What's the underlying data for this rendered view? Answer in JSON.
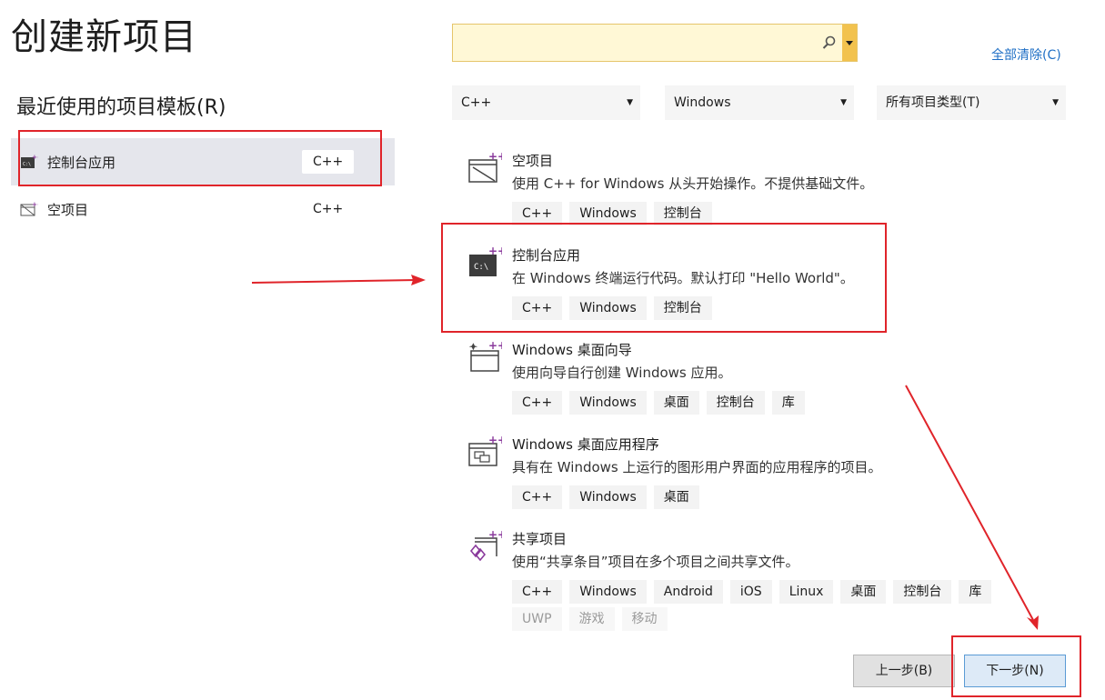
{
  "header": {
    "title": "创建新项目",
    "recent_title": "最近使用的项目模板(R)"
  },
  "recent": [
    {
      "label": "控制台应用",
      "tag": "C++",
      "icon": "console-app-icon",
      "selected": true
    },
    {
      "label": "空项目",
      "tag": "C++",
      "icon": "empty-project-icon",
      "selected": false
    }
  ],
  "search": {
    "value": "",
    "placeholder": ""
  },
  "clear_all": "全部清除(C)",
  "filters": {
    "language": "C++",
    "platform": "Windows",
    "project_type": "所有项目类型(T)"
  },
  "templates": [
    {
      "name": "空项目",
      "desc": "使用 C++ for Windows 从头开始操作。不提供基础文件。",
      "tags": [
        "C++",
        "Windows",
        "控制台"
      ],
      "icon": "empty-project-icon"
    },
    {
      "name": "控制台应用",
      "desc": "在 Windows 终端运行代码。默认打印 \"Hello World\"。",
      "tags": [
        "C++",
        "Windows",
        "控制台"
      ],
      "icon": "console-app-icon"
    },
    {
      "name": "Windows 桌面向导",
      "desc": "使用向导自行创建 Windows 应用。",
      "tags": [
        "C++",
        "Windows",
        "桌面",
        "控制台",
        "库"
      ],
      "icon": "desktop-wizard-icon"
    },
    {
      "name": "Windows 桌面应用程序",
      "desc": "具有在 Windows 上运行的图形用户界面的应用程序的项目。",
      "tags": [
        "C++",
        "Windows",
        "桌面"
      ],
      "icon": "desktop-app-icon"
    },
    {
      "name": "共享项目",
      "desc": "使用“共享条目”项目在多个项目之间共享文件。",
      "tags": [
        "C++",
        "Windows",
        "Android",
        "iOS",
        "Linux",
        "桌面",
        "控制台",
        "库"
      ],
      "dim_tags": [
        "UWP",
        "游戏",
        "移动"
      ],
      "icon": "shared-project-icon"
    }
  ],
  "buttons": {
    "back": "上一步(B)",
    "next": "下一步(N)"
  },
  "colors": {
    "annotation_red": "#e0242a",
    "link_blue": "#1f6fc5",
    "template_purple": "#8a3a9c"
  }
}
